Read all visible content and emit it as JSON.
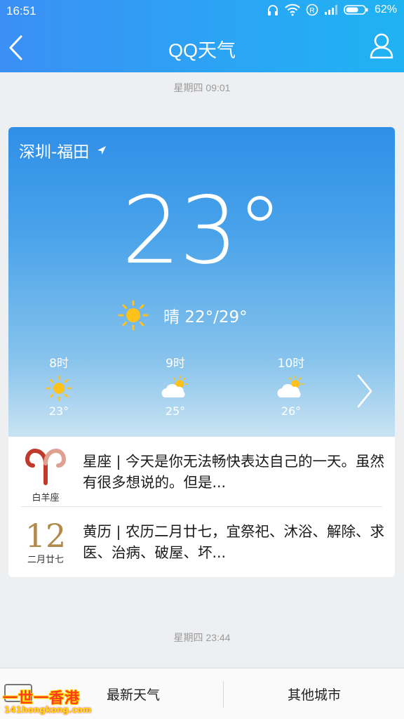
{
  "status_bar": {
    "time": "16:51",
    "battery": "62%"
  },
  "nav": {
    "title": "QQ天气"
  },
  "timestamps": {
    "first": "星期四 09:01",
    "second": "星期四 23:44"
  },
  "weather": {
    "location": "深圳-福田",
    "temperature": "23°",
    "today_summary": "晴 22°/29°",
    "hourly": [
      {
        "hour": "8时",
        "temp": "23°",
        "icon": "sun-icon"
      },
      {
        "hour": "9时",
        "temp": "25°",
        "icon": "partly-cloudy-icon"
      },
      {
        "hour": "10时",
        "temp": "26°",
        "icon": "partly-cloudy-icon"
      }
    ]
  },
  "horoscope": {
    "sign_label": "白羊座",
    "text": "星座 | 今天是你无法畅快表达自己的一天。虽然有很多想说的。但是..."
  },
  "almanac": {
    "day": "12",
    "lunar_date": "二月廿七",
    "text": "黄历 | 农历二月廿七，宜祭祀、沐浴、解除、求医、治病、破屋、坏..."
  },
  "bottom_tabs": {
    "latest": "最新天气",
    "other": "其他城市"
  },
  "watermark": {
    "main": "一世一香港",
    "sub": "141hongkong.com"
  },
  "colors": {
    "header": "#2aa6f4",
    "sun": "#ffc21a",
    "almanac_number": "#b08a4a",
    "aries": "#c0392b"
  }
}
